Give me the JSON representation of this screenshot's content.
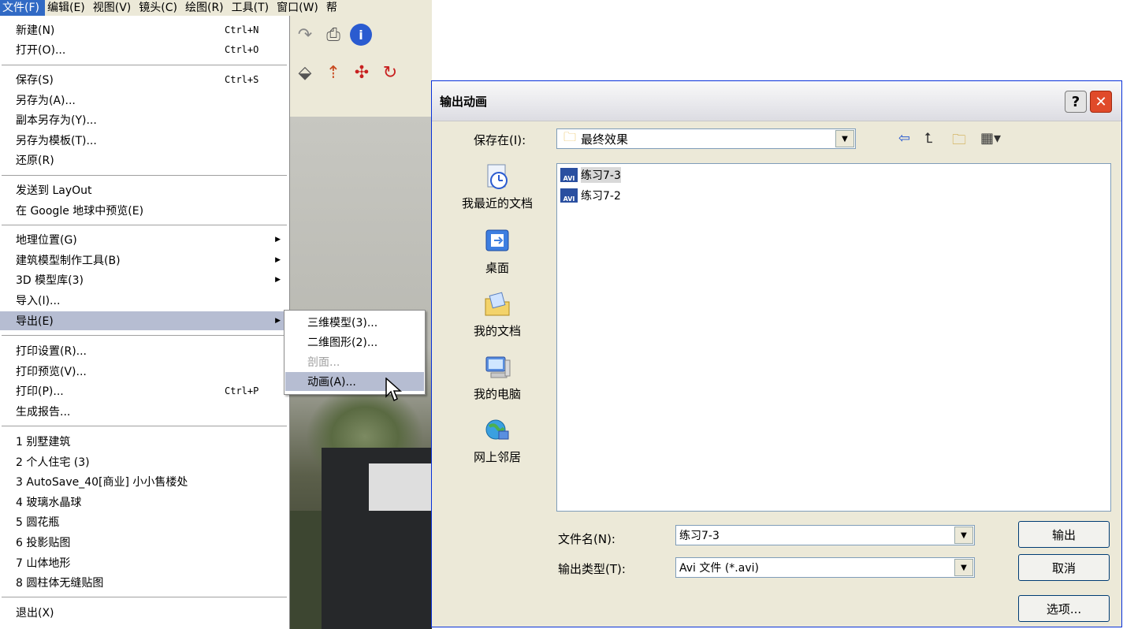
{
  "menubar": {
    "items": [
      {
        "label": "文件(F)"
      },
      {
        "label": "编辑(E)"
      },
      {
        "label": "视图(V)"
      },
      {
        "label": "镜头(C)"
      },
      {
        "label": "绘图(R)"
      },
      {
        "label": "工具(T)"
      },
      {
        "label": "窗口(W)"
      },
      {
        "label": "帮"
      }
    ]
  },
  "file_menu": {
    "items": [
      {
        "label": "新建(N)",
        "shortcut": "Ctrl+N"
      },
      {
        "label": "打开(O)...",
        "shortcut": "Ctrl+O"
      },
      {
        "label": "保存(S)",
        "shortcut": "Ctrl+S"
      },
      {
        "label": "另存为(A)..."
      },
      {
        "label": "副本另存为(Y)..."
      },
      {
        "label": "另存为模板(T)..."
      },
      {
        "label": "还原(R)"
      },
      {
        "label": "发送到 LayOut"
      },
      {
        "label": "在 Google 地球中预览(E)"
      },
      {
        "label": "地理位置(G)"
      },
      {
        "label": "建筑模型制作工具(B)"
      },
      {
        "label": "3D 模型库(3)"
      },
      {
        "label": "导入(I)..."
      },
      {
        "label": "导出(E)"
      },
      {
        "label": "打印设置(R)..."
      },
      {
        "label": "打印预览(V)..."
      },
      {
        "label": "打印(P)...",
        "shortcut": "Ctrl+P"
      },
      {
        "label": "生成报告..."
      },
      {
        "label": "1 别墅建筑"
      },
      {
        "label": "2 个人住宅 (3)"
      },
      {
        "label": "3 AutoSave_40[商业] 小小售楼处"
      },
      {
        "label": "4 玻璃水晶球"
      },
      {
        "label": "5 圆花瓶"
      },
      {
        "label": "6 投影贴图"
      },
      {
        "label": "7 山体地形"
      },
      {
        "label": "8 圆柱体无缝贴图"
      },
      {
        "label": "退出(X)"
      }
    ]
  },
  "export_submenu": {
    "items": [
      {
        "label": "三维模型(3)...",
        "enabled": true
      },
      {
        "label": "二维图形(2)...",
        "enabled": true
      },
      {
        "label": "剖面...",
        "enabled": false
      },
      {
        "label": "动画(A)...",
        "enabled": true
      }
    ]
  },
  "dialog": {
    "title": "输出动画",
    "help_label": "?",
    "close_label": "✕",
    "save_in_label": "保存在(I):",
    "current_folder": "最终效果",
    "places": [
      {
        "label": "我最近的文档",
        "icon": "recent-documents-icon"
      },
      {
        "label": "桌面",
        "icon": "desktop-icon"
      },
      {
        "label": "我的文档",
        "icon": "my-documents-icon"
      },
      {
        "label": "我的电脑",
        "icon": "my-computer-icon"
      },
      {
        "label": "网上邻居",
        "icon": "network-places-icon"
      }
    ],
    "files": [
      {
        "name": "练习7-3",
        "type_badge": "AVI",
        "selected": true
      },
      {
        "name": "练习7-2",
        "type_badge": "AVI",
        "selected": false
      }
    ],
    "filename_label": "文件名(N):",
    "filename_value": "练习7-3",
    "filetype_label": "输出类型(T):",
    "filetype_value": "Avi 文件 (*.avi)",
    "export_button": "输出",
    "cancel_button": "取消",
    "options_button": "选项..."
  },
  "colors": {
    "menu_highlight": "#b6bdd2",
    "dialog_face": "#ece9d8",
    "close_button": "#e04a2a"
  }
}
